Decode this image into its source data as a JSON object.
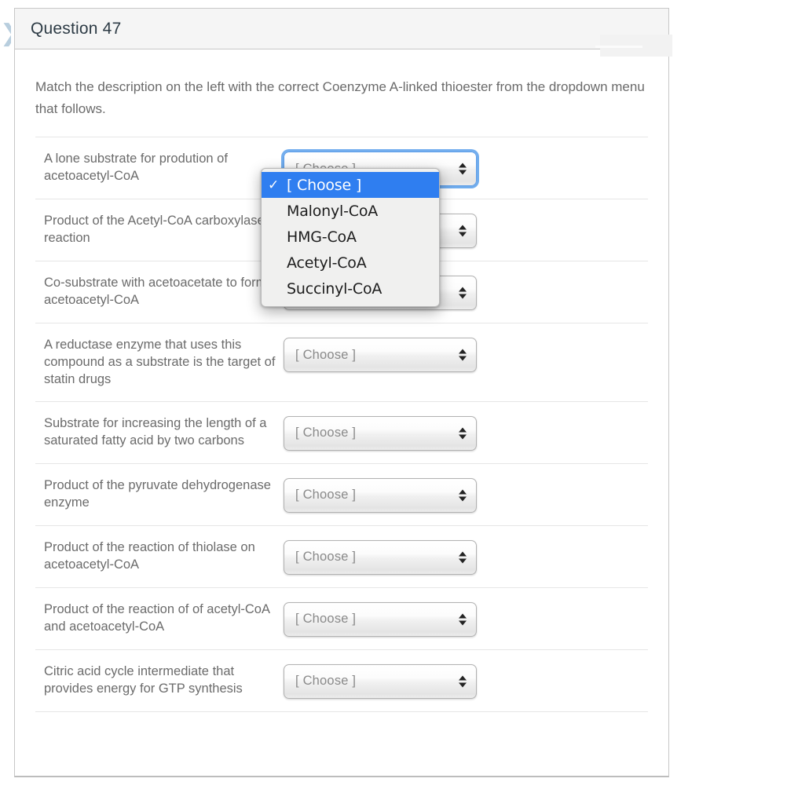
{
  "page": {
    "background_color": "#ffffff",
    "edge_chevron_icon": "❯"
  },
  "question_card": {
    "header": {
      "title": "Question 47"
    },
    "instruction": "Match the description on the left with the correct Coenzyme A-linked thioester from the dropdown menu that follows.",
    "select_placeholder": "[ Choose ]",
    "rows": [
      {
        "label": "A lone substrate for prodution of acetoacetyl-CoA",
        "value": "[ Choose ]",
        "focused": true
      },
      {
        "label": "Product of the Acetyl-CoA carboxylase reaction",
        "value": "[ Choose ]",
        "focused": false
      },
      {
        "label": "Co-substrate with acetoacetate to form acetoacetyl-CoA",
        "value": "[ Choose ]",
        "focused": false
      },
      {
        "label": "A reductase enzyme that uses this compound as a substrate is the target of statin drugs",
        "value": "[ Choose ]",
        "focused": false
      },
      {
        "label": "Substrate for increasing the length of a saturated fatty acid by two carbons",
        "value": "[ Choose ]",
        "focused": false
      },
      {
        "label": "Product of the pyruvate dehydrogenase enzyme",
        "value": "[ Choose ]",
        "focused": false
      },
      {
        "label": "Product of the reaction of thiolase on acetoacetyl-CoA",
        "value": "[ Choose ]",
        "focused": false
      },
      {
        "label": "Product of the reaction of of acetyl-CoA and acetoacetyl-CoA",
        "value": "[ Choose ]",
        "focused": false
      },
      {
        "label": "Citric acid cycle intermediate that provides energy for GTP synthesis",
        "value": "[ Choose ]",
        "focused": false
      }
    ]
  },
  "open_dropdown": {
    "attached_to_row": 0,
    "checkmark_icon": "✓",
    "selected_index": 0,
    "options": [
      "[ Choose ]",
      "Malonyl-CoA",
      "HMG-CoA",
      "Acetyl-CoA",
      "Succinyl-CoA"
    ]
  },
  "colors": {
    "card_border": "#c7c7c7",
    "header_bg": "#f5f5f5",
    "header_text": "#2d3b45",
    "body_text": "#6b6b6b",
    "divider": "#e6e6e6",
    "dropdown_highlight": "#2f7ef0",
    "focus_ring": "#5e9ee8",
    "chevron": "#b8cede"
  }
}
